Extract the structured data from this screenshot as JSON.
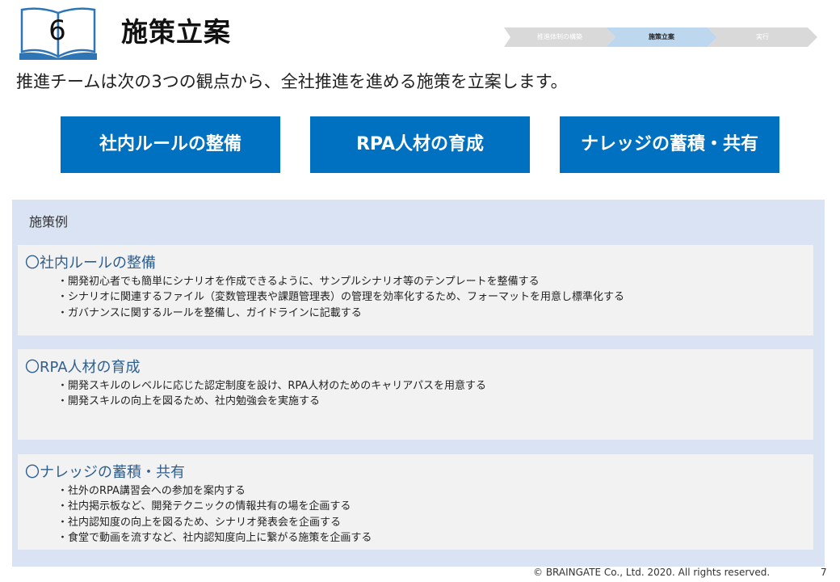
{
  "header": {
    "chapter_number": "6",
    "title": "施策立案",
    "steps": [
      "推進体制の構築",
      "施策立案",
      "実行"
    ]
  },
  "intro": "推進チームは次の3つの観点から、全社推進を進める施策を立案します。",
  "categories": [
    "社内ルールの整備",
    "RPA人材の育成",
    "ナレッジの蓄積・共有"
  ],
  "examples": {
    "label": "施策例",
    "sections": [
      {
        "title": "〇社内ルールの整備",
        "items": [
          "・開発初心者でも簡単にシナリオを作成できるように、サンプルシナリオ等のテンプレートを整備する",
          "・シナリオに関連するファイル（変数管理表や課題管理表）の管理を効率化するため、フォーマットを用意し標準化する",
          "・ガバナンスに関するルールを整備し、ガイドラインに記載する"
        ]
      },
      {
        "title": "〇RPA人材の育成",
        "items": [
          "・開発スキルのレベルに応じた認定制度を設け、RPA人材のためのキャリアパスを用意する",
          "・開発スキルの向上を図るため、社内勉強会を実施する"
        ]
      },
      {
        "title": "〇ナレッジの蓄積・共有",
        "items": [
          "・社外のRPA講習会への参加を案内する",
          "・社内掲示板など、開発テクニックの情報共有の場を企画する",
          "・社内認知度の向上を図るため、シナリオ発表会を企画する",
          "・食堂で動画を流すなど、社内認知度向上に繋がる施策を企画する"
        ]
      }
    ]
  },
  "footer": {
    "copyright": "© BRAINGATE Co., Ltd. 2020. All rights reserved.",
    "page_number": "7"
  },
  "colors": {
    "accent": "#0070c0",
    "panel": "#dae3f3",
    "card": "#f2f2f2",
    "step_inactive": "#d9d9d9",
    "step_active": "#bdd7ee"
  }
}
